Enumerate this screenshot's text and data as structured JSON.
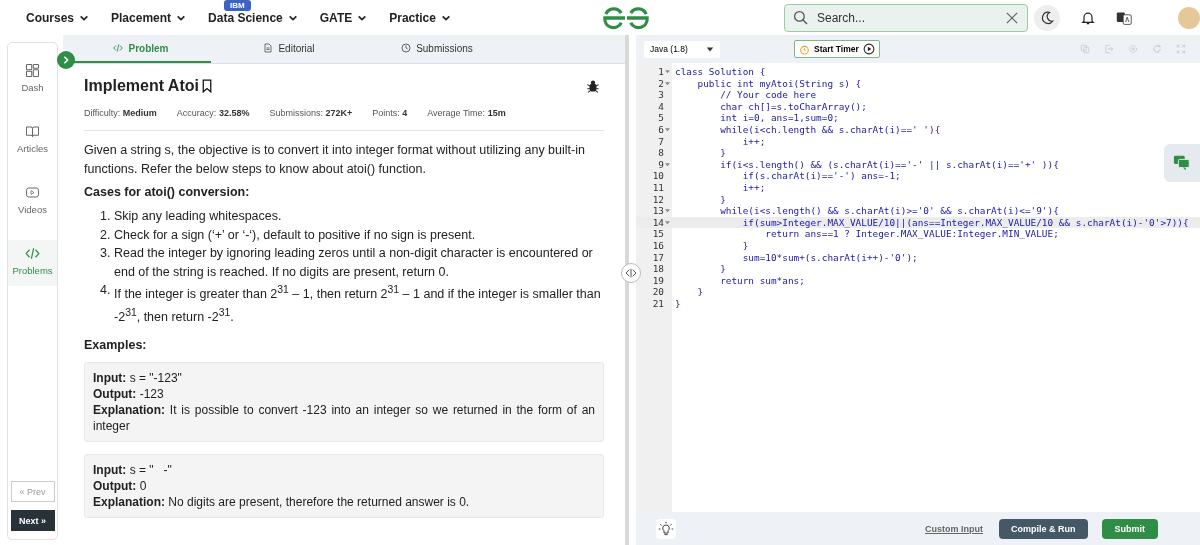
{
  "nav": {
    "items": [
      {
        "label": "Courses"
      },
      {
        "label": "Placement"
      },
      {
        "label": "Data Science",
        "badge": "IBM"
      },
      {
        "label": "GATE"
      },
      {
        "label": "Practice"
      }
    ],
    "search": {
      "placeholder": "Search..."
    }
  },
  "sidebar": {
    "items": [
      {
        "label": "Dash",
        "selected": false
      },
      {
        "label": "Articles",
        "selected": false
      },
      {
        "label": "Videos",
        "selected": false
      },
      {
        "label": "Problems",
        "selected": true
      }
    ],
    "prev": "« Prev",
    "next": "Next »"
  },
  "tabs": [
    {
      "label": "Problem",
      "selected": true
    },
    {
      "label": "Editorial",
      "selected": false
    },
    {
      "label": "Submissions",
      "selected": false
    }
  ],
  "problem": {
    "title": "Implement Atoi",
    "meta": [
      {
        "label": "Difficulty:",
        "value": "Medium"
      },
      {
        "label": "Accuracy:",
        "value": "32.58%"
      },
      {
        "label": "Submissions:",
        "value": "272K+"
      },
      {
        "label": "Points:",
        "value": "4"
      },
      {
        "label": "Average Time:",
        "value": "15m"
      }
    ],
    "description": "Given a string s, the objective is to convert it into integer format without utilizing any built-in functions. Refer the below steps to know about atoi() function.",
    "cases_heading": "Cases for atoi() conversion:",
    "cases": [
      {
        "n": "1.",
        "text": "Skip any leading whitespaces."
      },
      {
        "n": "2.",
        "text": "Check for a sign (‘+’ or ‘-‘), default to positive if no sign is present."
      },
      {
        "n": "3.",
        "text": "Read the integer by ignoring leading zeros until a non-digit character is encountered or end of the string is reached. If no digits are present, return 0."
      },
      {
        "n": "4.",
        "text": "If the integer is greater than 2$^{31}$ – 1, then return 2$^{31}$ – 1 and if the integer is smaller than -2$^{31}$, then return -2$^{31}$."
      }
    ],
    "examples_heading": "Examples:",
    "examples": [
      {
        "fields": [
          {
            "label": "Input:",
            "value": "s = \"-123\""
          },
          {
            "label": "Output:",
            "value": "-123"
          },
          {
            "label": "Explanation:",
            "value": "It is possible to convert -123 into an integer so we returned in the form of an integer"
          }
        ]
      },
      {
        "fields": [
          {
            "label": "Input:",
            "value": "s = \"   -\""
          },
          {
            "label": "Output:",
            "value": "0"
          },
          {
            "label": "Explanation:",
            "value": "No digits are present, therefore the returned answer is 0."
          }
        ]
      }
    ]
  },
  "editor": {
    "language": "Java (1.8)",
    "timer": "Start Timer",
    "lines": [
      {
        "n": "1",
        "code": "class Solution {",
        "fold": true,
        "current": false
      },
      {
        "n": "2",
        "code": "    public int myAtoi(String s) {",
        "fold": true,
        "current": false
      },
      {
        "n": "3",
        "code": "        // Your code here",
        "fold": false,
        "current": false
      },
      {
        "n": "4",
        "code": "        char ch[]=s.toCharArray();",
        "fold": false,
        "current": false
      },
      {
        "n": "5",
        "code": "        int i=0, ans=1,sum=0;",
        "fold": false,
        "current": false
      },
      {
        "n": "6",
        "code": "        while(i<ch.length && s.charAt(i)==' '){",
        "fold": true,
        "current": false
      },
      {
        "n": "7",
        "code": "            i++;",
        "fold": false,
        "current": false
      },
      {
        "n": "8",
        "code": "        }",
        "fold": false,
        "current": false
      },
      {
        "n": "9",
        "code": "        if(i<s.length() && (s.charAt(i)=='-' || s.charAt(i)=='+' )){",
        "fold": true,
        "current": false
      },
      {
        "n": "10",
        "code": "            if(s.charAt(i)=='-') ans=-1;",
        "fold": false,
        "current": false
      },
      {
        "n": "11",
        "code": "            i++;",
        "fold": false,
        "current": false
      },
      {
        "n": "12",
        "code": "        }",
        "fold": false,
        "current": false
      },
      {
        "n": "13",
        "code": "        while(i<s.length() && s.charAt(i)>='0' && s.charAt(i)<='9'){",
        "fold": true,
        "current": false
      },
      {
        "n": "14",
        "code": "            if(sum>Integer.MAX_VALUE/10||(ans==Integer.MAX_VALUE/10 && s.charAt(i)-'0'>7)){",
        "fold": true,
        "current": true
      },
      {
        "n": "15",
        "code": "                return ans==1 ? Integer.MAX_VALUE:Integer.MIN_VALUE;",
        "fold": false,
        "current": false
      },
      {
        "n": "16",
        "code": "            }",
        "fold": false,
        "current": false
      },
      {
        "n": "17",
        "code": "            sum=10*sum+(s.charAt(i++)-'0');",
        "fold": false,
        "current": false
      },
      {
        "n": "18",
        "code": "        }",
        "fold": false,
        "current": false
      },
      {
        "n": "19",
        "code": "        return sum*ans;",
        "fold": false,
        "current": false
      },
      {
        "n": "20",
        "code": "    }",
        "fold": false,
        "current": false
      },
      {
        "n": "21",
        "code": "}",
        "fold": false,
        "current": false
      }
    ],
    "custom_input": "Custom Input",
    "compile": "Compile & Run",
    "submit": "Submit"
  }
}
